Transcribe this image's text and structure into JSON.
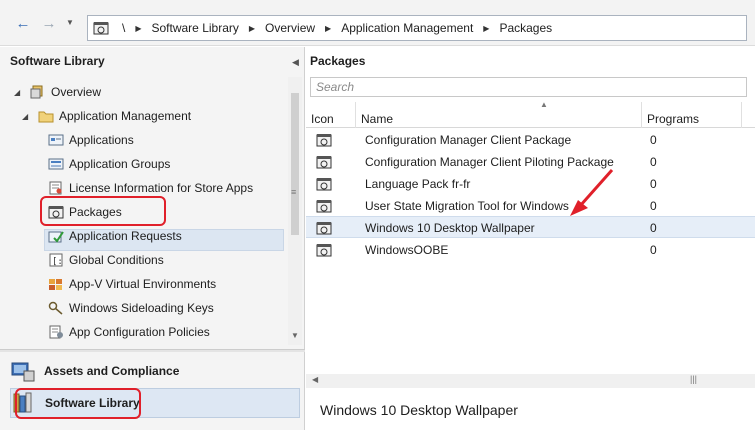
{
  "navbar": {
    "back_icon": "back-arrow-icon",
    "forward_icon": "forward-arrow-icon",
    "breadcrumb": [
      "\\",
      "Software Library",
      "Overview",
      "Application Management",
      "Packages"
    ]
  },
  "left_pane": {
    "title": "Software Library",
    "tree": [
      {
        "label": "Overview",
        "icon": "overview-icon",
        "level": 0,
        "expanded": true
      },
      {
        "label": "Application Management",
        "icon": "folder-icon",
        "level": 1,
        "expanded": true
      },
      {
        "label": "Applications",
        "icon": "applications-icon",
        "level": 2
      },
      {
        "label": "Application Groups",
        "icon": "application-groups-icon",
        "level": 2
      },
      {
        "label": "License Information for Store Apps",
        "icon": "license-icon",
        "level": 2
      },
      {
        "label": "Packages",
        "icon": "package-icon",
        "level": 2,
        "selected": true
      },
      {
        "label": "Application Requests",
        "icon": "requests-icon",
        "level": 2
      },
      {
        "label": "Global Conditions",
        "icon": "conditions-icon",
        "level": 2
      },
      {
        "label": "App-V Virtual Environments",
        "icon": "appv-icon",
        "level": 2
      },
      {
        "label": "Windows Sideloading Keys",
        "icon": "key-icon",
        "level": 2
      },
      {
        "label": "App Configuration Policies",
        "icon": "policy-icon",
        "level": 2
      }
    ],
    "workspaces": [
      {
        "label": "Assets and Compliance",
        "icon": "assets-icon",
        "active": false
      },
      {
        "label": "Software Library",
        "icon": "software-library-icon",
        "active": true
      }
    ]
  },
  "right_pane": {
    "title": "Packages",
    "search_placeholder": "Search",
    "columns": [
      "Icon",
      "Name",
      "Programs"
    ],
    "rows": [
      {
        "name": "Configuration Manager Client Package",
        "programs": "0"
      },
      {
        "name": "Configuration Manager Client Piloting Package",
        "programs": "0"
      },
      {
        "name": "Language Pack fr-fr",
        "programs": "0"
      },
      {
        "name": "User State Migration Tool for Windows",
        "programs": "0"
      },
      {
        "name": "Windows 10 Desktop Wallpaper",
        "programs": "0",
        "selected": true
      },
      {
        "name": "WindowsOOBE",
        "programs": "0"
      }
    ],
    "detail_title": "Windows 10 Desktop Wallpaper"
  },
  "colors": {
    "highlight": "#e0202a",
    "selection": "#dce6f2"
  }
}
